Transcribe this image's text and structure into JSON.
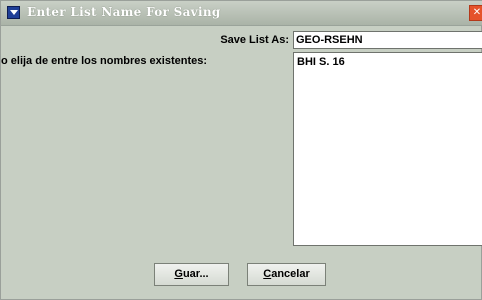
{
  "window": {
    "title": "Enter List Name For Saving"
  },
  "form": {
    "save_label": "Save List As:",
    "save_value": "GEO-RSEHN",
    "existing_label": "o elija de entre los nombres existentes:",
    "existing_items": [
      "BHI S. 16"
    ]
  },
  "buttons": {
    "save_mnemonic": "G",
    "save_rest": "uar...",
    "cancel_mnemonic": "C",
    "cancel_rest": "ancelar"
  },
  "icons": {
    "app": "list-icon",
    "close": "close-icon"
  },
  "colors": {
    "dialog_bg": "#c7cfc3",
    "titlebar": "#aab3a7",
    "close": "#e5532b",
    "app_icon": "#1f3f97"
  }
}
